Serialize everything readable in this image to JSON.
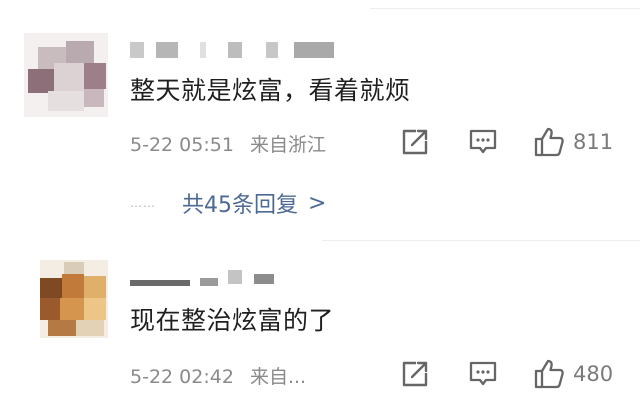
{
  "comments": [
    {
      "text": "整天就是炫富，看着就烦",
      "date": "5-22 05:51",
      "location": "来自浙江",
      "likes": "811",
      "replies_label": "共45条回复",
      "replies_chevron": ">",
      "dots": "……"
    },
    {
      "text": "现在整治炫富的了",
      "date": "5-22 02:42",
      "location": "来自...",
      "likes": "480"
    }
  ],
  "icons": {
    "share": "share-icon",
    "reply": "comment-icon",
    "like": "thumbs-up-icon"
  },
  "colors": {
    "text": "#1f1f1f",
    "meta": "#8a8a8a",
    "link": "#4d6a94",
    "icon": "#666666"
  }
}
